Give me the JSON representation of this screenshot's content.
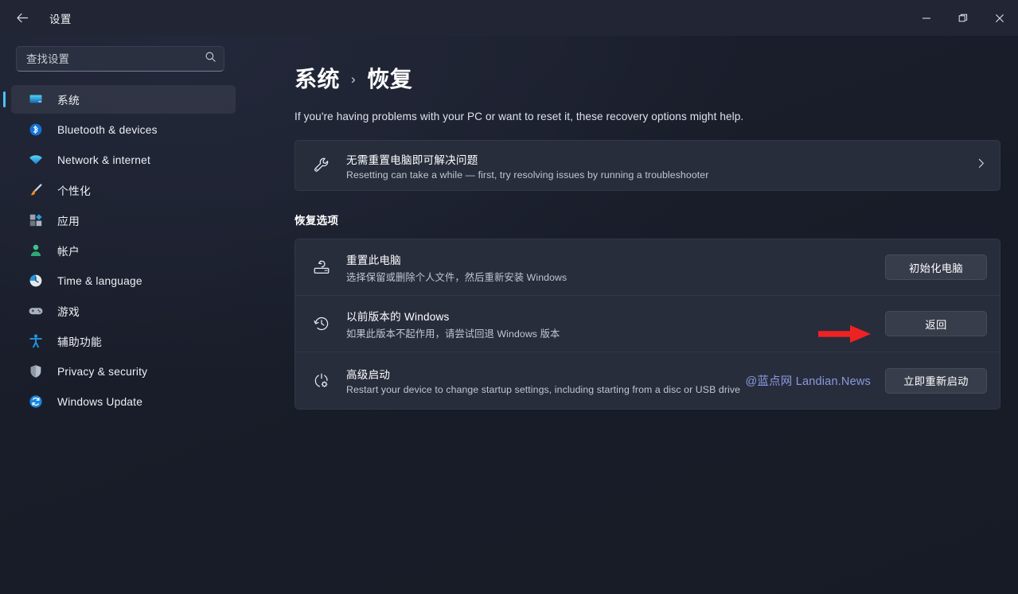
{
  "window": {
    "title": "设置",
    "back_icon": "arrow-left-icon",
    "controls": {
      "minimize": "minimize-icon",
      "maximize": "restore-icon",
      "close": "close-icon"
    }
  },
  "search": {
    "placeholder": "查找设置",
    "value": "",
    "icon": "search-icon"
  },
  "sidebar": {
    "items": [
      {
        "label": "系统",
        "icon": "monitor-icon",
        "active": true
      },
      {
        "label": "Bluetooth & devices",
        "icon": "bluetooth-icon",
        "active": false
      },
      {
        "label": "Network & internet",
        "icon": "wifi-icon",
        "active": false
      },
      {
        "label": "个性化",
        "icon": "paintbrush-icon",
        "active": false
      },
      {
        "label": "应用",
        "icon": "apps-icon",
        "active": false
      },
      {
        "label": "帐户",
        "icon": "person-icon",
        "active": false
      },
      {
        "label": "Time & language",
        "icon": "clock-icon",
        "active": false
      },
      {
        "label": "游戏",
        "icon": "gamepad-icon",
        "active": false
      },
      {
        "label": "辅助功能",
        "icon": "accessibility-icon",
        "active": false
      },
      {
        "label": "Privacy & security",
        "icon": "shield-icon",
        "active": false
      },
      {
        "label": "Windows Update",
        "icon": "update-icon",
        "active": false
      }
    ]
  },
  "main": {
    "breadcrumb": {
      "root": "系统",
      "separator": "›",
      "current": "恢复"
    },
    "subtitle": "If you're having problems with your PC or want to reset it, these recovery options might help.",
    "banner": {
      "icon": "wrench-icon",
      "title": "无需重置电脑即可解决问题",
      "desc": "Resetting can take a while — first, try resolving issues by running a troubleshooter",
      "chevron": "chevron-right-icon"
    },
    "section_label": "恢复选项",
    "options": [
      {
        "icon": "reset-pc-icon",
        "title": "重置此电脑",
        "desc": "选择保留或删除个人文件，然后重新安装 Windows",
        "button": "初始化电脑",
        "watermark": "",
        "highlighted": false
      },
      {
        "icon": "history-icon",
        "title": "以前版本的 Windows",
        "desc": "如果此版本不起作用，请尝试回退 Windows 版本",
        "button": "返回",
        "watermark": "",
        "highlighted": true
      },
      {
        "icon": "power-gear-icon",
        "title": "高级启动",
        "desc": "Restart your device to change startup settings, including starting from a disc or USB drive",
        "button": "立即重新启动",
        "watermark": "@蓝点网 Landian.News",
        "highlighted": false
      }
    ]
  },
  "annotation": {
    "type": "red-arrow",
    "color": "#ee2222",
    "points_to": "返回"
  },
  "colors": {
    "accent": "#4cc2ff",
    "background": "#1b1f2d",
    "card": "#282d3c",
    "watermark": "#8a9ae0",
    "annotation": "#ee2222"
  }
}
